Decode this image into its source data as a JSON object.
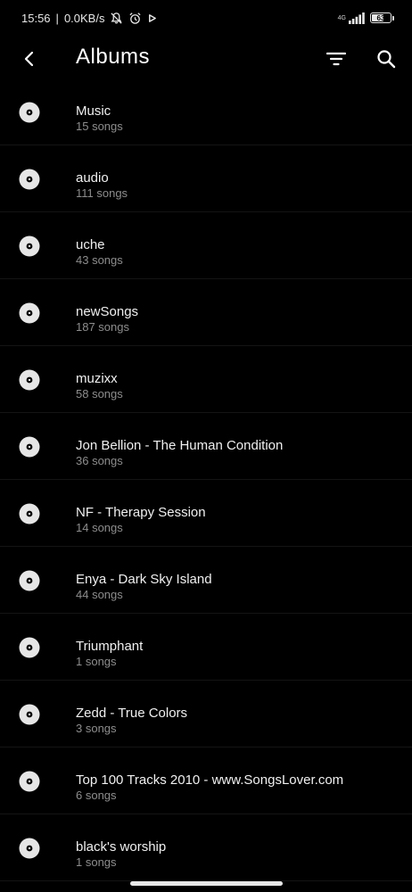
{
  "status_bar": {
    "time": "15:56",
    "network_speed": "0.0KB/s",
    "network_type": "4G",
    "battery_level": "63",
    "icons": [
      "mute-bell-icon",
      "alarm-icon",
      "play-icon",
      "signal-icon",
      "battery-icon"
    ]
  },
  "header": {
    "title": "Albums",
    "back_icon": "back-arrow-icon",
    "filter_icon": "filter-icon",
    "search_icon": "search-icon"
  },
  "albums": [
    {
      "title": "Music",
      "count": "15 songs"
    },
    {
      "title": "audio",
      "count": "111 songs"
    },
    {
      "title": "uche",
      "count": "43 songs"
    },
    {
      "title": "newSongs",
      "count": "187 songs"
    },
    {
      "title": "muzixx",
      "count": "58 songs"
    },
    {
      "title": "Jon Bellion - The Human Condition",
      "count": "36 songs"
    },
    {
      "title": "NF - Therapy Session",
      "count": "14 songs"
    },
    {
      "title": "Enya - Dark Sky Island",
      "count": "44 songs"
    },
    {
      "title": "Triumphant",
      "count": "1 songs"
    },
    {
      "title": "Zedd - True Colors",
      "count": "3 songs"
    },
    {
      "title": "Top 100 Tracks 2010 - www.SongsLover.com",
      "count": "6 songs"
    },
    {
      "title": "black's worship",
      "count": "1 songs"
    }
  ],
  "colors": {
    "background": "#000000",
    "title_text": "#f0f0f0",
    "secondary_text": "#8d8d8d",
    "divider": "#141414",
    "disc": "#e6e6e6"
  }
}
